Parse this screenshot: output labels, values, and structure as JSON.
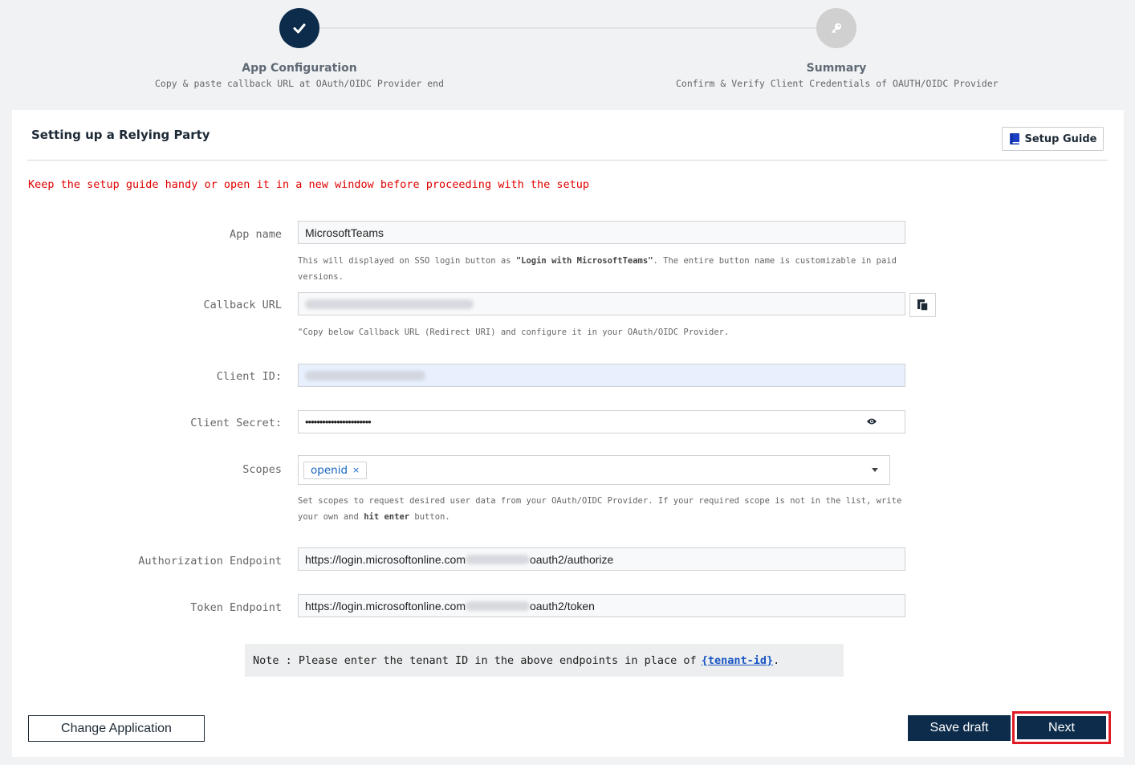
{
  "stepper": {
    "steps": [
      {
        "title": "App Configuration",
        "subtitle": "Copy & paste callback URL at OAuth/OIDC Provider end",
        "status": "done"
      },
      {
        "title": "Summary",
        "subtitle": "Confirm & Verify Client Credentials of OAUTH/OIDC Provider",
        "status": "pending"
      }
    ]
  },
  "card": {
    "title": "Setting up a Relying Party",
    "guide_button": "Setup Guide",
    "warning": "Keep the setup guide handy or open it in a new window before proceeding with the setup"
  },
  "form": {
    "app_name": {
      "label": "App name",
      "value": "MicrosoftTeams",
      "help_prefix": "This will displayed on SSO login button as ",
      "help_bold": "\"Login with MicrosoftTeams\"",
      "help_suffix": ". The entire button name is customizable in paid versions."
    },
    "callback_url": {
      "label": "Callback URL",
      "help": "\"Copy below Callback URL (Redirect URI) and configure it in your OAuth/OIDC Provider."
    },
    "client_id": {
      "label": "Client ID:"
    },
    "client_secret": {
      "label": "Client Secret:",
      "value": "•••••••••••••••••••••••"
    },
    "scopes": {
      "label": "Scopes",
      "selected": "openid",
      "remove": "×",
      "help_prefix": "Set scopes to request desired user data from your OAuth/OIDC Provider. If your required scope is not in the list, write your own and ",
      "help_bold": "hit enter",
      "help_suffix": " button."
    },
    "authorization_endpoint": {
      "label": "Authorization Endpoint",
      "value_start": "https://login.microsoftonline.com",
      "value_end": "oauth2/authorize"
    },
    "token_endpoint": {
      "label": "Token Endpoint",
      "value_start": "https://login.microsoftonline.com",
      "value_end": "oauth2/token"
    }
  },
  "note": {
    "text": "Note : Please enter the tenant ID in the above endpoints in place of",
    "link": "{tenant-id}",
    "suffix": "."
  },
  "buttons": {
    "change_application": "Change Application",
    "save_draft": "Save draft",
    "next": "Next"
  },
  "colors": {
    "primary": "#0d2c4b",
    "warning": "#e00000",
    "highlight": "#e01b24",
    "link": "#1a56c4"
  }
}
